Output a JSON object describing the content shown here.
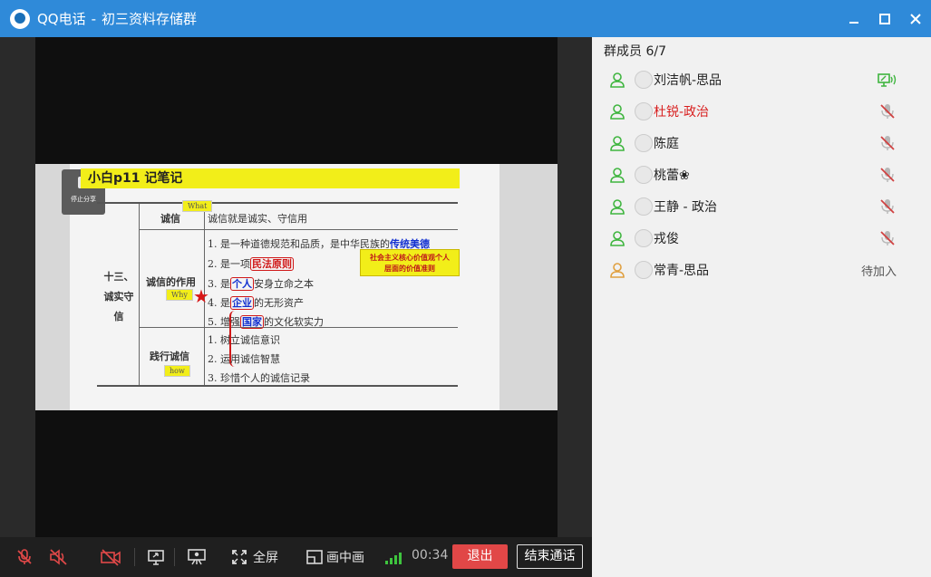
{
  "window": {
    "app_name": "QQ电话",
    "separator": "-",
    "group_name": "初三资料存储群"
  },
  "slide": {
    "title": "小白p11 记笔记",
    "stop_share_label": "停止分享",
    "category": [
      "十三、",
      "诚实守",
      "信"
    ],
    "callout": [
      "社会主义核心价值观个人",
      "层面的价值准则"
    ],
    "rows": [
      {
        "heading": "诚信",
        "tag": "What",
        "lines": [
          "诚信就是诚实、守信用"
        ]
      },
      {
        "heading": "诚信的作用",
        "tag": "Why",
        "lines": [
          "1. 是一种道德规范和品质，是中华民族的",
          "2. 是一项",
          "3. 是",
          "4. 是",
          "5. 增强"
        ],
        "line_keywords": [
          "传统美德",
          "民法原则",
          "个人",
          "企业",
          "国家"
        ],
        "line_tails": [
          "",
          "",
          "安身立命之本",
          "的无形资产",
          "的文化软实力"
        ]
      },
      {
        "heading": "践行诚信",
        "tag": "how",
        "lines": [
          "1. 树立诚信意识",
          "2. 运用诚信智慧",
          "3. 珍惜个人的诚信记录"
        ]
      }
    ]
  },
  "toolbar": {
    "fullscreen_label": "全屏",
    "pip_label": "画中画",
    "timer": "00:34",
    "exit_label": "退出",
    "end_call_label": "结束通话"
  },
  "panel": {
    "header": "群成员 6/7",
    "members": [
      {
        "name": "刘洁帆-思品",
        "status": "sharing",
        "color": "#222222"
      },
      {
        "name": "杜锐-政治",
        "status": "muted",
        "color": "#d81e1e"
      },
      {
        "name": "陈庭",
        "status": "muted",
        "color": "#222222"
      },
      {
        "name": "桃蕾❀",
        "status": "muted",
        "color": "#222222"
      },
      {
        "name": "王静 - 政治",
        "status": "muted",
        "color": "#222222"
      },
      {
        "name": "戎俊",
        "status": "muted",
        "color": "#222222"
      },
      {
        "name": "常青-思品",
        "status": "waiting",
        "waiting_label": "待加入",
        "color": "#222222"
      }
    ]
  },
  "colors": {
    "titlebar": "#2f8ad9",
    "exit_button": "#e14747",
    "online_person": "#3fb53f",
    "waiting_person": "#e0a040",
    "muted": "#d04040",
    "signal": "#3ec43e"
  }
}
